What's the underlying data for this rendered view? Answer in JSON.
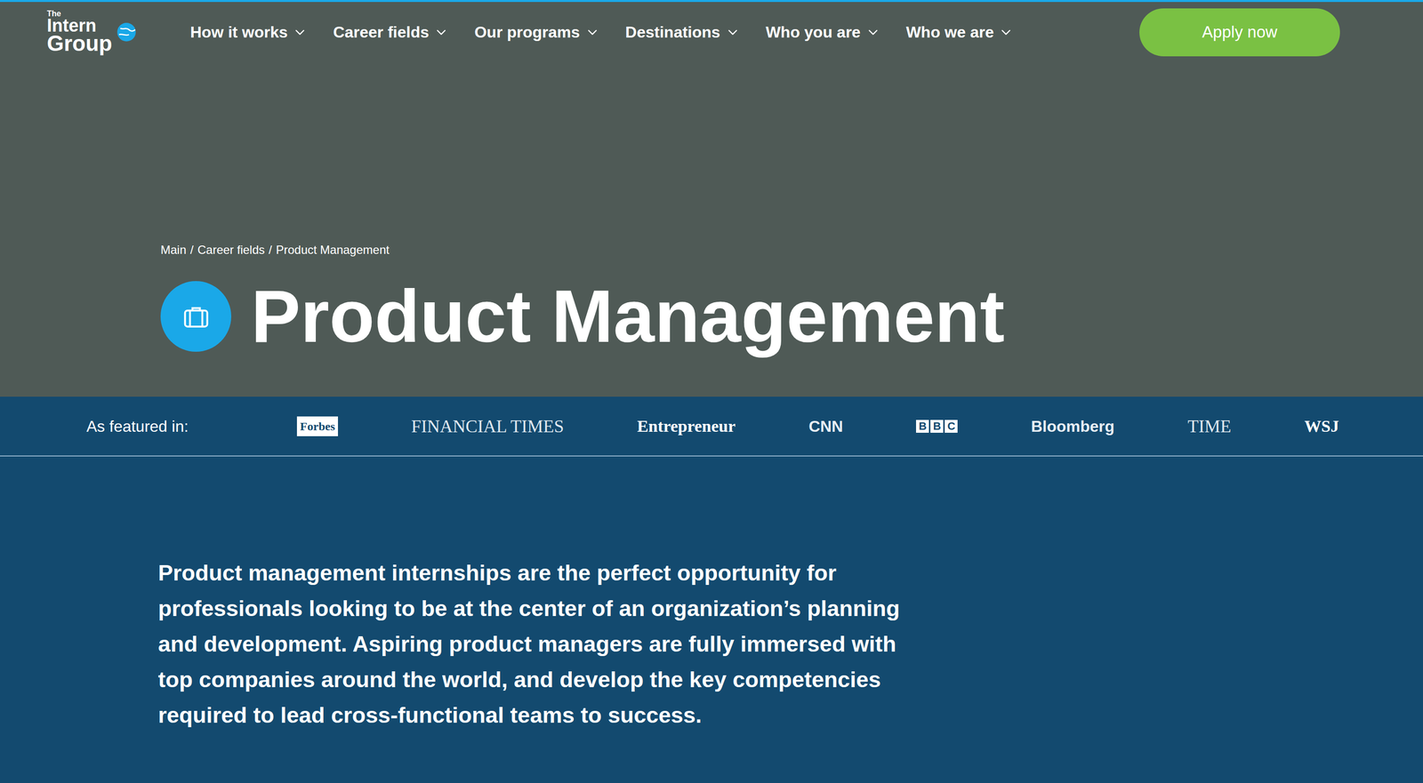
{
  "logo": {
    "small": "The",
    "line1": "Intern",
    "line2": "Group"
  },
  "nav": [
    {
      "label": "How it works"
    },
    {
      "label": "Career fields"
    },
    {
      "label": "Our programs"
    },
    {
      "label": "Destinations"
    },
    {
      "label": "Who you are"
    },
    {
      "label": "Who we are"
    }
  ],
  "apply_button": "Apply now",
  "hero": {
    "breadcrumb": [
      "Main",
      "Career fields",
      "Product Management"
    ],
    "separator": "/",
    "title": "Product Management"
  },
  "featured": {
    "label": "As featured in:",
    "outlets": [
      {
        "name": "Forbes",
        "kind": "boxed"
      },
      {
        "name": "FINANCIAL TIMES",
        "kind": "serif"
      },
      {
        "name": "Entrepreneur",
        "kind": "serifbold"
      },
      {
        "name": "CNN",
        "kind": "sans"
      },
      {
        "name": "BBC",
        "kind": "blocks"
      },
      {
        "name": "Bloomberg",
        "kind": "sans"
      },
      {
        "name": "TIME",
        "kind": "serif"
      },
      {
        "name": "WSJ",
        "kind": "serifbold"
      }
    ]
  },
  "intro": "Product management internships are the perfect opportunity for professionals looking to be at the center of an organization’s planning and development. Aspiring product managers are fully immersed with top companies around the world, and develop the key competencies required to lead cross-functional teams to success."
}
